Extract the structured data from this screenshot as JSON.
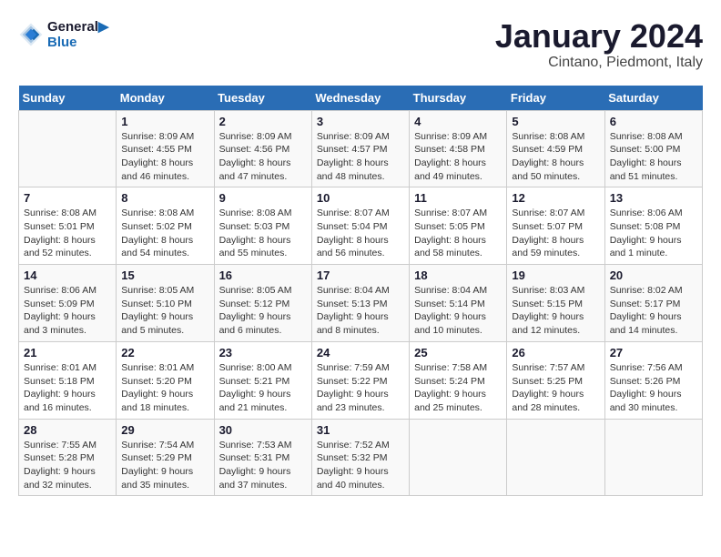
{
  "logo": {
    "line1": "General",
    "line2": "Blue"
  },
  "title": "January 2024",
  "location": "Cintano, Piedmont, Italy",
  "days_of_week": [
    "Sunday",
    "Monday",
    "Tuesday",
    "Wednesday",
    "Thursday",
    "Friday",
    "Saturday"
  ],
  "weeks": [
    [
      {
        "day": "",
        "info": ""
      },
      {
        "day": "1",
        "info": "Sunrise: 8:09 AM\nSunset: 4:55 PM\nDaylight: 8 hours\nand 46 minutes."
      },
      {
        "day": "2",
        "info": "Sunrise: 8:09 AM\nSunset: 4:56 PM\nDaylight: 8 hours\nand 47 minutes."
      },
      {
        "day": "3",
        "info": "Sunrise: 8:09 AM\nSunset: 4:57 PM\nDaylight: 8 hours\nand 48 minutes."
      },
      {
        "day": "4",
        "info": "Sunrise: 8:09 AM\nSunset: 4:58 PM\nDaylight: 8 hours\nand 49 minutes."
      },
      {
        "day": "5",
        "info": "Sunrise: 8:08 AM\nSunset: 4:59 PM\nDaylight: 8 hours\nand 50 minutes."
      },
      {
        "day": "6",
        "info": "Sunrise: 8:08 AM\nSunset: 5:00 PM\nDaylight: 8 hours\nand 51 minutes."
      }
    ],
    [
      {
        "day": "7",
        "info": "Sunrise: 8:08 AM\nSunset: 5:01 PM\nDaylight: 8 hours\nand 52 minutes."
      },
      {
        "day": "8",
        "info": "Sunrise: 8:08 AM\nSunset: 5:02 PM\nDaylight: 8 hours\nand 54 minutes."
      },
      {
        "day": "9",
        "info": "Sunrise: 8:08 AM\nSunset: 5:03 PM\nDaylight: 8 hours\nand 55 minutes."
      },
      {
        "day": "10",
        "info": "Sunrise: 8:07 AM\nSunset: 5:04 PM\nDaylight: 8 hours\nand 56 minutes."
      },
      {
        "day": "11",
        "info": "Sunrise: 8:07 AM\nSunset: 5:05 PM\nDaylight: 8 hours\nand 58 minutes."
      },
      {
        "day": "12",
        "info": "Sunrise: 8:07 AM\nSunset: 5:07 PM\nDaylight: 8 hours\nand 59 minutes."
      },
      {
        "day": "13",
        "info": "Sunrise: 8:06 AM\nSunset: 5:08 PM\nDaylight: 9 hours\nand 1 minute."
      }
    ],
    [
      {
        "day": "14",
        "info": "Sunrise: 8:06 AM\nSunset: 5:09 PM\nDaylight: 9 hours\nand 3 minutes."
      },
      {
        "day": "15",
        "info": "Sunrise: 8:05 AM\nSunset: 5:10 PM\nDaylight: 9 hours\nand 5 minutes."
      },
      {
        "day": "16",
        "info": "Sunrise: 8:05 AM\nSunset: 5:12 PM\nDaylight: 9 hours\nand 6 minutes."
      },
      {
        "day": "17",
        "info": "Sunrise: 8:04 AM\nSunset: 5:13 PM\nDaylight: 9 hours\nand 8 minutes."
      },
      {
        "day": "18",
        "info": "Sunrise: 8:04 AM\nSunset: 5:14 PM\nDaylight: 9 hours\nand 10 minutes."
      },
      {
        "day": "19",
        "info": "Sunrise: 8:03 AM\nSunset: 5:15 PM\nDaylight: 9 hours\nand 12 minutes."
      },
      {
        "day": "20",
        "info": "Sunrise: 8:02 AM\nSunset: 5:17 PM\nDaylight: 9 hours\nand 14 minutes."
      }
    ],
    [
      {
        "day": "21",
        "info": "Sunrise: 8:01 AM\nSunset: 5:18 PM\nDaylight: 9 hours\nand 16 minutes."
      },
      {
        "day": "22",
        "info": "Sunrise: 8:01 AM\nSunset: 5:20 PM\nDaylight: 9 hours\nand 18 minutes."
      },
      {
        "day": "23",
        "info": "Sunrise: 8:00 AM\nSunset: 5:21 PM\nDaylight: 9 hours\nand 21 minutes."
      },
      {
        "day": "24",
        "info": "Sunrise: 7:59 AM\nSunset: 5:22 PM\nDaylight: 9 hours\nand 23 minutes."
      },
      {
        "day": "25",
        "info": "Sunrise: 7:58 AM\nSunset: 5:24 PM\nDaylight: 9 hours\nand 25 minutes."
      },
      {
        "day": "26",
        "info": "Sunrise: 7:57 AM\nSunset: 5:25 PM\nDaylight: 9 hours\nand 28 minutes."
      },
      {
        "day": "27",
        "info": "Sunrise: 7:56 AM\nSunset: 5:26 PM\nDaylight: 9 hours\nand 30 minutes."
      }
    ],
    [
      {
        "day": "28",
        "info": "Sunrise: 7:55 AM\nSunset: 5:28 PM\nDaylight: 9 hours\nand 32 minutes."
      },
      {
        "day": "29",
        "info": "Sunrise: 7:54 AM\nSunset: 5:29 PM\nDaylight: 9 hours\nand 35 minutes."
      },
      {
        "day": "30",
        "info": "Sunrise: 7:53 AM\nSunset: 5:31 PM\nDaylight: 9 hours\nand 37 minutes."
      },
      {
        "day": "31",
        "info": "Sunrise: 7:52 AM\nSunset: 5:32 PM\nDaylight: 9 hours\nand 40 minutes."
      },
      {
        "day": "",
        "info": ""
      },
      {
        "day": "",
        "info": ""
      },
      {
        "day": "",
        "info": ""
      }
    ]
  ]
}
